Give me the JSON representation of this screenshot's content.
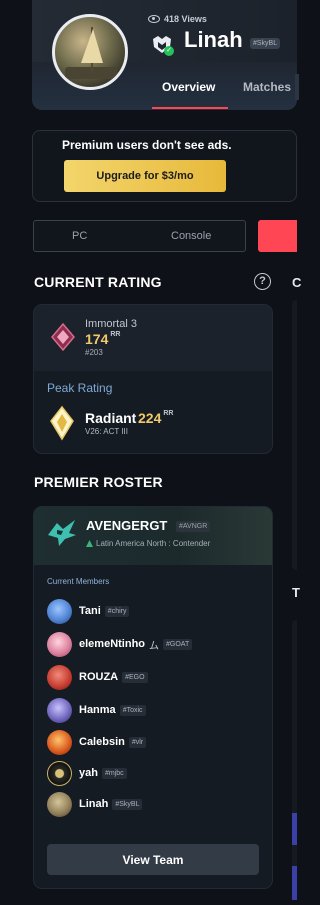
{
  "profile": {
    "views": "418 Views",
    "name": "Linah",
    "tag": "#SkyBL",
    "verified_symbol": "✓",
    "tabs": [
      "Overview",
      "Matches"
    ],
    "active_tab": "Overview"
  },
  "premium": {
    "text": "Premium users don't see ads.",
    "button": "Upgrade for $3/mo"
  },
  "platform": {
    "options": [
      "PC",
      "Console"
    ]
  },
  "current_rating": {
    "title": "CURRENT RATING",
    "help": "?",
    "rank": "Immortal 3",
    "rr": "174",
    "rr_unit": "RR",
    "position": "#203",
    "peak_label": "Peak Rating",
    "peak_rank": "Radiant",
    "peak_rr": "224",
    "peak_rr_unit": "RR",
    "peak_act": "V26: ACT III"
  },
  "sidebar_letters": [
    "C",
    "T"
  ],
  "premier": {
    "title": "PREMIER ROSTER",
    "team_name": "AVENGERGT",
    "team_tag": "#AVNGR",
    "region": "Latin America North : Contender",
    "members_label": "Current Members",
    "members": [
      {
        "name": "Tani",
        "tag": "#chiry",
        "extra": "",
        "color": "#4b7fd0"
      },
      {
        "name": "elemeNtinho",
        "tag": "#GOAT",
        "extra": "ム",
        "color": "#d97b9a"
      },
      {
        "name": "ROUZA",
        "tag": "#EGO",
        "extra": "",
        "color": "#c43a2e"
      },
      {
        "name": "Hanma",
        "tag": "#Toxic",
        "extra": "",
        "color": "#6b62b8"
      },
      {
        "name": "Calebsin",
        "tag": "#vlr",
        "extra": "",
        "color": "#d8561c"
      },
      {
        "name": "yah",
        "tag": "#mjbc",
        "extra": "",
        "color": "#2b2a24"
      },
      {
        "name": "Linah",
        "tag": "#SkyBL",
        "extra": "",
        "color": "#8c7b55"
      }
    ],
    "view_button": "View Team"
  },
  "colors": {
    "accent_red": "#ff4655",
    "gold": "#f0c96a",
    "peak_blue": "#7fa9d6"
  }
}
